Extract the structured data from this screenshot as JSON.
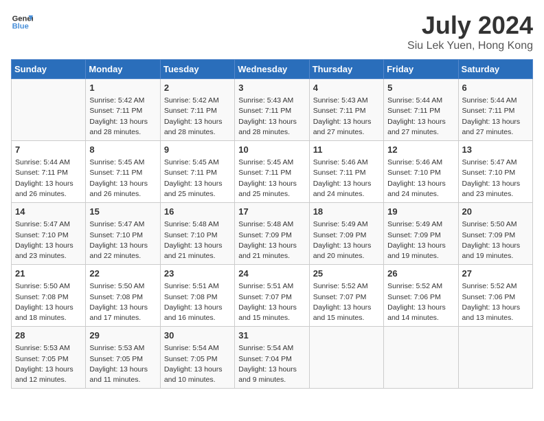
{
  "header": {
    "logo_line1": "General",
    "logo_line2": "Blue",
    "month_year": "July 2024",
    "location": "Siu Lek Yuen, Hong Kong"
  },
  "days_of_week": [
    "Sunday",
    "Monday",
    "Tuesday",
    "Wednesday",
    "Thursday",
    "Friday",
    "Saturday"
  ],
  "weeks": [
    [
      {
        "day": "",
        "sunrise": "",
        "sunset": "",
        "daylight": ""
      },
      {
        "day": "1",
        "sunrise": "Sunrise: 5:42 AM",
        "sunset": "Sunset: 7:11 PM",
        "daylight": "Daylight: 13 hours and 28 minutes."
      },
      {
        "day": "2",
        "sunrise": "Sunrise: 5:42 AM",
        "sunset": "Sunset: 7:11 PM",
        "daylight": "Daylight: 13 hours and 28 minutes."
      },
      {
        "day": "3",
        "sunrise": "Sunrise: 5:43 AM",
        "sunset": "Sunset: 7:11 PM",
        "daylight": "Daylight: 13 hours and 28 minutes."
      },
      {
        "day": "4",
        "sunrise": "Sunrise: 5:43 AM",
        "sunset": "Sunset: 7:11 PM",
        "daylight": "Daylight: 13 hours and 27 minutes."
      },
      {
        "day": "5",
        "sunrise": "Sunrise: 5:44 AM",
        "sunset": "Sunset: 7:11 PM",
        "daylight": "Daylight: 13 hours and 27 minutes."
      },
      {
        "day": "6",
        "sunrise": "Sunrise: 5:44 AM",
        "sunset": "Sunset: 7:11 PM",
        "daylight": "Daylight: 13 hours and 27 minutes."
      }
    ],
    [
      {
        "day": "7",
        "sunrise": "Sunrise: 5:44 AM",
        "sunset": "Sunset: 7:11 PM",
        "daylight": "Daylight: 13 hours and 26 minutes."
      },
      {
        "day": "8",
        "sunrise": "Sunrise: 5:45 AM",
        "sunset": "Sunset: 7:11 PM",
        "daylight": "Daylight: 13 hours and 26 minutes."
      },
      {
        "day": "9",
        "sunrise": "Sunrise: 5:45 AM",
        "sunset": "Sunset: 7:11 PM",
        "daylight": "Daylight: 13 hours and 25 minutes."
      },
      {
        "day": "10",
        "sunrise": "Sunrise: 5:45 AM",
        "sunset": "Sunset: 7:11 PM",
        "daylight": "Daylight: 13 hours and 25 minutes."
      },
      {
        "day": "11",
        "sunrise": "Sunrise: 5:46 AM",
        "sunset": "Sunset: 7:11 PM",
        "daylight": "Daylight: 13 hours and 24 minutes."
      },
      {
        "day": "12",
        "sunrise": "Sunrise: 5:46 AM",
        "sunset": "Sunset: 7:10 PM",
        "daylight": "Daylight: 13 hours and 24 minutes."
      },
      {
        "day": "13",
        "sunrise": "Sunrise: 5:47 AM",
        "sunset": "Sunset: 7:10 PM",
        "daylight": "Daylight: 13 hours and 23 minutes."
      }
    ],
    [
      {
        "day": "14",
        "sunrise": "Sunrise: 5:47 AM",
        "sunset": "Sunset: 7:10 PM",
        "daylight": "Daylight: 13 hours and 23 minutes."
      },
      {
        "day": "15",
        "sunrise": "Sunrise: 5:47 AM",
        "sunset": "Sunset: 7:10 PM",
        "daylight": "Daylight: 13 hours and 22 minutes."
      },
      {
        "day": "16",
        "sunrise": "Sunrise: 5:48 AM",
        "sunset": "Sunset: 7:10 PM",
        "daylight": "Daylight: 13 hours and 21 minutes."
      },
      {
        "day": "17",
        "sunrise": "Sunrise: 5:48 AM",
        "sunset": "Sunset: 7:09 PM",
        "daylight": "Daylight: 13 hours and 21 minutes."
      },
      {
        "day": "18",
        "sunrise": "Sunrise: 5:49 AM",
        "sunset": "Sunset: 7:09 PM",
        "daylight": "Daylight: 13 hours and 20 minutes."
      },
      {
        "day": "19",
        "sunrise": "Sunrise: 5:49 AM",
        "sunset": "Sunset: 7:09 PM",
        "daylight": "Daylight: 13 hours and 19 minutes."
      },
      {
        "day": "20",
        "sunrise": "Sunrise: 5:50 AM",
        "sunset": "Sunset: 7:09 PM",
        "daylight": "Daylight: 13 hours and 19 minutes."
      }
    ],
    [
      {
        "day": "21",
        "sunrise": "Sunrise: 5:50 AM",
        "sunset": "Sunset: 7:08 PM",
        "daylight": "Daylight: 13 hours and 18 minutes."
      },
      {
        "day": "22",
        "sunrise": "Sunrise: 5:50 AM",
        "sunset": "Sunset: 7:08 PM",
        "daylight": "Daylight: 13 hours and 17 minutes."
      },
      {
        "day": "23",
        "sunrise": "Sunrise: 5:51 AM",
        "sunset": "Sunset: 7:08 PM",
        "daylight": "Daylight: 13 hours and 16 minutes."
      },
      {
        "day": "24",
        "sunrise": "Sunrise: 5:51 AM",
        "sunset": "Sunset: 7:07 PM",
        "daylight": "Daylight: 13 hours and 15 minutes."
      },
      {
        "day": "25",
        "sunrise": "Sunrise: 5:52 AM",
        "sunset": "Sunset: 7:07 PM",
        "daylight": "Daylight: 13 hours and 15 minutes."
      },
      {
        "day": "26",
        "sunrise": "Sunrise: 5:52 AM",
        "sunset": "Sunset: 7:06 PM",
        "daylight": "Daylight: 13 hours and 14 minutes."
      },
      {
        "day": "27",
        "sunrise": "Sunrise: 5:52 AM",
        "sunset": "Sunset: 7:06 PM",
        "daylight": "Daylight: 13 hours and 13 minutes."
      }
    ],
    [
      {
        "day": "28",
        "sunrise": "Sunrise: 5:53 AM",
        "sunset": "Sunset: 7:05 PM",
        "daylight": "Daylight: 13 hours and 12 minutes."
      },
      {
        "day": "29",
        "sunrise": "Sunrise: 5:53 AM",
        "sunset": "Sunset: 7:05 PM",
        "daylight": "Daylight: 13 hours and 11 minutes."
      },
      {
        "day": "30",
        "sunrise": "Sunrise: 5:54 AM",
        "sunset": "Sunset: 7:05 PM",
        "daylight": "Daylight: 13 hours and 10 minutes."
      },
      {
        "day": "31",
        "sunrise": "Sunrise: 5:54 AM",
        "sunset": "Sunset: 7:04 PM",
        "daylight": "Daylight: 13 hours and 9 minutes."
      },
      {
        "day": "",
        "sunrise": "",
        "sunset": "",
        "daylight": ""
      },
      {
        "day": "",
        "sunrise": "",
        "sunset": "",
        "daylight": ""
      },
      {
        "day": "",
        "sunrise": "",
        "sunset": "",
        "daylight": ""
      }
    ]
  ]
}
